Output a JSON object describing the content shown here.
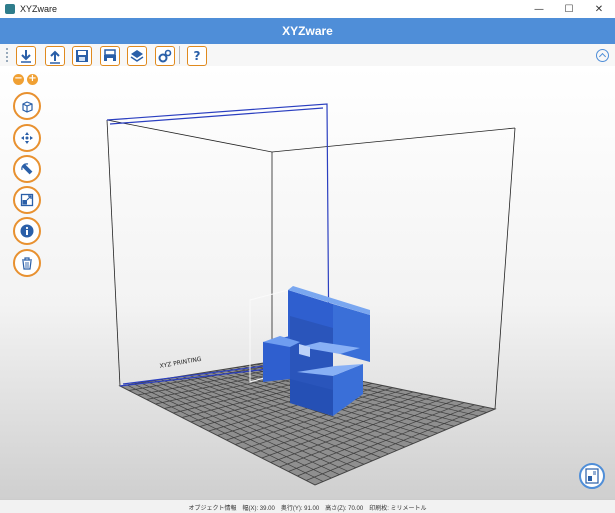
{
  "window": {
    "title": "XYZware"
  },
  "header": {
    "title": "XYZware"
  },
  "toolbar": {
    "buttons": [
      {
        "name": "import-button",
        "icon": "arrow-down-icon"
      },
      {
        "name": "export-button",
        "icon": "arrow-up-icon"
      },
      {
        "name": "save-button",
        "icon": "floppy-icon"
      },
      {
        "name": "print-button",
        "icon": "printer-icon"
      },
      {
        "name": "layers-button",
        "icon": "layers-icon"
      },
      {
        "name": "settings-button",
        "icon": "gear-icon"
      },
      {
        "name": "help-button",
        "icon": "question-icon",
        "label": "?"
      }
    ]
  },
  "viewport": {
    "zoom_out": "−",
    "zoom_in": "+",
    "side_tools": [
      "view-cube",
      "move",
      "rotate",
      "scale",
      "info",
      "delete"
    ],
    "model_color": "#3a6fd8",
    "bed_label": "XYZ PRINTING"
  },
  "status": {
    "object_info": "オブジェクト情報",
    "x": "幅(X): 39.00",
    "y": "奥行(Y): 91.00",
    "z": "高さ(Z): 70.00",
    "unit": "印刷枚: ミリメートル"
  }
}
